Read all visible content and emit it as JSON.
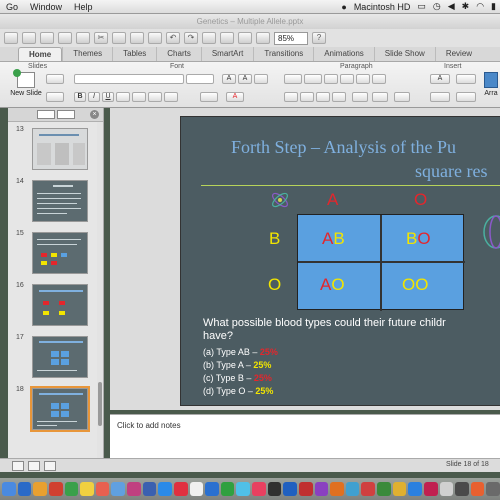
{
  "menubar": {
    "items": [
      "Go",
      "Window",
      "Help"
    ],
    "drive": "Macintosh HD"
  },
  "window_title": "Genetics – Multiple Allele.pptx",
  "toolbar": {
    "zoom": "85%"
  },
  "ribbon": {
    "tabs": [
      "Home",
      "Themes",
      "Tables",
      "Charts",
      "SmartArt",
      "Transitions",
      "Animations",
      "Slide Show",
      "Review"
    ],
    "groups": [
      "Slides",
      "Font",
      "Paragraph",
      "Insert"
    ],
    "new_slide_label": "New Slide",
    "arrange_label": "Arra"
  },
  "thumbnails": [
    {
      "num": "13"
    },
    {
      "num": "14"
    },
    {
      "num": "15"
    },
    {
      "num": "16"
    },
    {
      "num": "17"
    },
    {
      "num": "18"
    }
  ],
  "slide": {
    "title_line1": "Forth Step – Analysis of the Pu",
    "title_line2": "square res",
    "allele_top": [
      "A",
      "O"
    ],
    "allele_side": [
      "B",
      "O"
    ],
    "cells": {
      "r1c1": {
        "a": "A",
        "b": "B"
      },
      "r1c2": {
        "a": "B",
        "b": "O"
      },
      "r2c1": {
        "a": "A",
        "b": "O"
      },
      "r2c2": {
        "a": "O",
        "b": "O"
      }
    },
    "question_line1": "What possible blood types could their future childr",
    "question_line2": "have?",
    "answers": [
      {
        "label": "(a) Type AB –",
        "pct": "25%",
        "color": "#e4262c"
      },
      {
        "label": "(b) Type A –",
        "pct": "25%",
        "color": "#f2e500"
      },
      {
        "label": "(c) Type B –",
        "pct": "25%",
        "color": "#e4262c"
      },
      {
        "label": "(d) Type O –",
        "pct": "25%",
        "color": "#f2e500"
      }
    ]
  },
  "notes": {
    "placeholder": "Click to add notes"
  },
  "status": {
    "slide_count": "Slide 18 of 18"
  },
  "colors": {
    "red": "#e4262c",
    "yellow": "#f2e500",
    "cell_blue": "#5aa0e0",
    "title_blue": "#7fb0df"
  }
}
